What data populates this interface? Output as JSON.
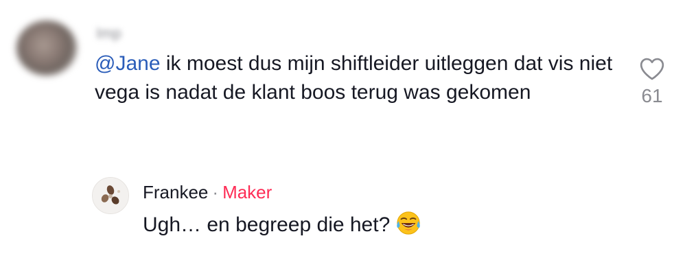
{
  "comment": {
    "username": "Imp",
    "mention": "@Jane",
    "text": " ik moest dus mijn shiftleider uitleggen dat vis niet vega is nadat de klant boos terug was gekomen",
    "like_count": "61"
  },
  "reply": {
    "author": "Frankee",
    "separator": "·",
    "badge": "Maker",
    "text": "Ugh… en begreep die het?",
    "emoji": "face-with-tears-of-joy-icon"
  },
  "colors": {
    "mention": "#2b5db9",
    "badge": "#fe2c55",
    "muted": "#8a8b91",
    "text": "#161823"
  }
}
